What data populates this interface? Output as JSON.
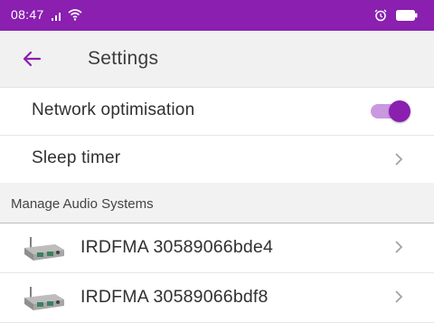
{
  "status_bar": {
    "time": "08:47",
    "icons": [
      "signal-icon",
      "wifi-icon",
      "alarm-icon",
      "battery-icon"
    ]
  },
  "app_bar": {
    "back_icon": "arrow-left-icon",
    "title": "Settings"
  },
  "settings": {
    "network_optimisation": {
      "label": "Network optimisation",
      "enabled": true
    },
    "sleep_timer": {
      "label": "Sleep timer"
    }
  },
  "section": {
    "title": "Manage Audio Systems"
  },
  "devices": [
    {
      "label": "IRDFMA 30589066bde4"
    },
    {
      "label": "IRDFMA 30589066bdf8"
    }
  ],
  "colors": {
    "accent": "#8a1fb0",
    "toggle_track": "#c998e0",
    "app_bar_bg": "#f1f1f1",
    "section_bg": "#f2f2f2"
  }
}
